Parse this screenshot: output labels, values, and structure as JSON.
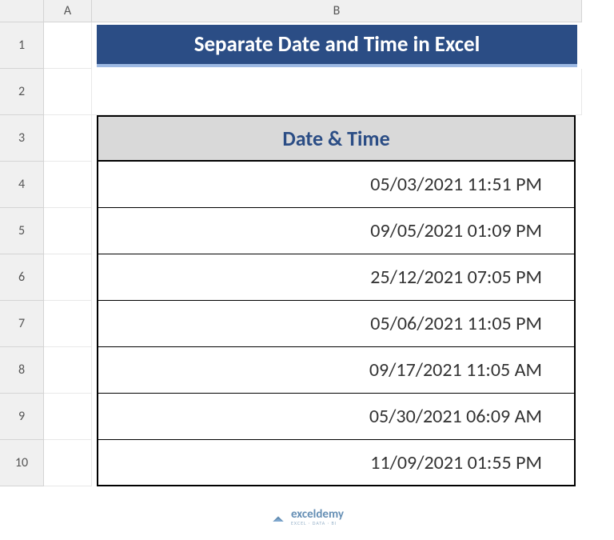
{
  "columns": [
    "A",
    "B"
  ],
  "rows": [
    "1",
    "2",
    "3",
    "4",
    "5",
    "6",
    "7",
    "8",
    "9",
    "10"
  ],
  "title": "Separate Date and Time in Excel",
  "table": {
    "header": "Date & Time",
    "values": [
      "05/03/2021 11:51 PM",
      "09/05/2021 01:09 PM",
      "25/12/2021  07:05 PM",
      "05/06/2021 11:05 PM",
      "09/17/2021 11:05 AM",
      "05/30/2021 06:09 AM",
      "11/09/2021 01:55 PM"
    ]
  },
  "watermark": {
    "main": "exceldemy",
    "sub": "EXCEL · DATA · BI"
  }
}
